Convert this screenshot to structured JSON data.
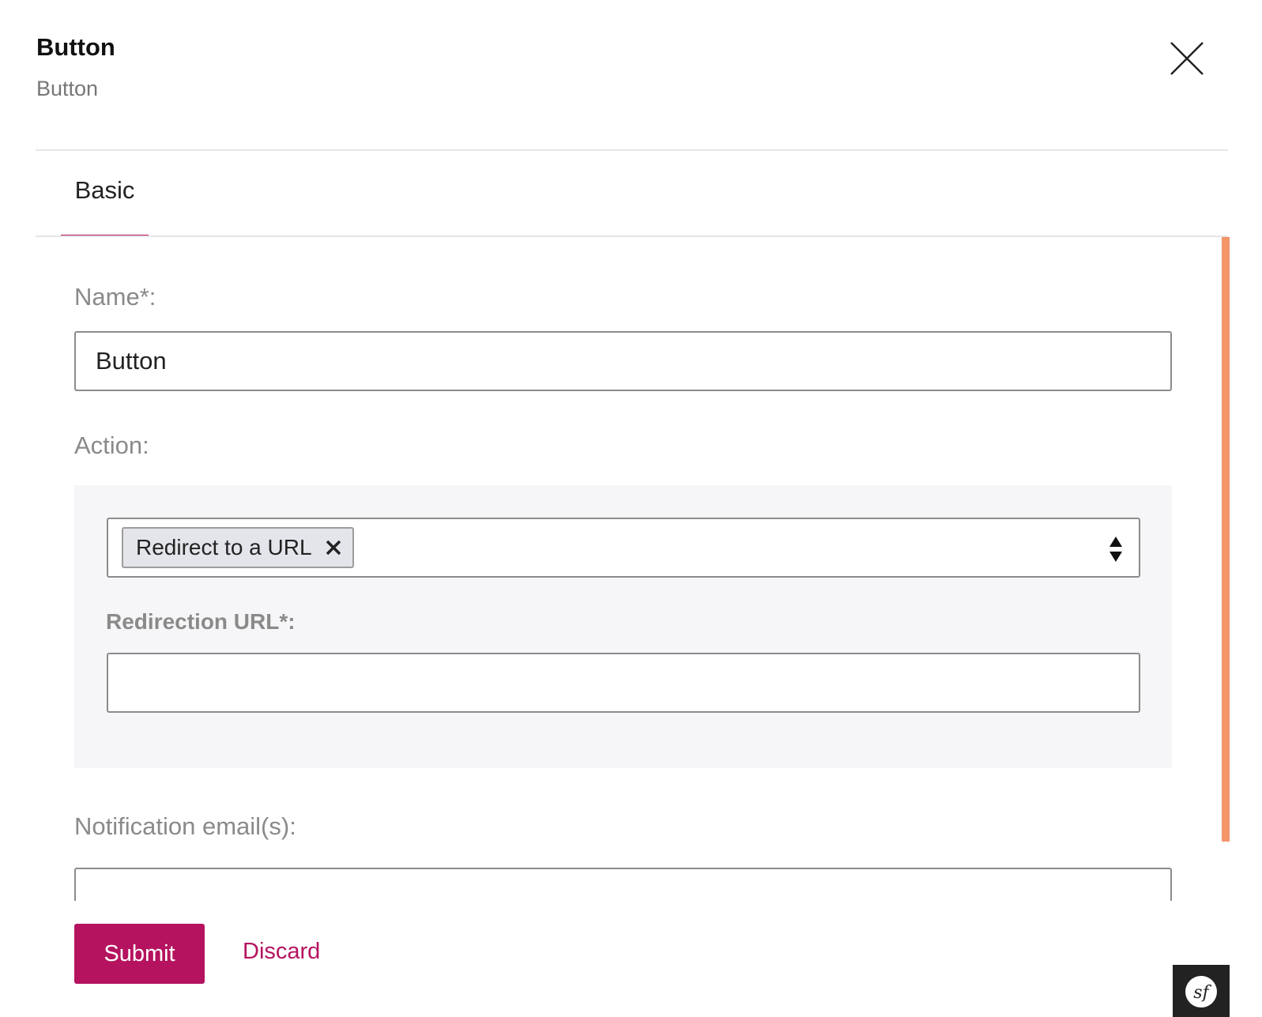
{
  "header": {
    "title": "Button",
    "subtitle": "Button",
    "close_icon": "close-icon"
  },
  "tabs": [
    {
      "label": "Basic",
      "active": true
    }
  ],
  "form": {
    "name": {
      "label": "Name*:",
      "value": "Button"
    },
    "action": {
      "label": "Action:",
      "selected_chip": "Redirect to a URL",
      "chip_remove_icon": "close-small-icon",
      "select_icon": "select-arrows-icon",
      "redirection_url": {
        "label": "Redirection URL*:",
        "value": ""
      }
    },
    "notification_emails": {
      "label": "Notification email(s):",
      "value": ""
    }
  },
  "footer": {
    "submit_label": "Submit",
    "discard_label": "Discard"
  },
  "colors": {
    "accent": "#b5135f",
    "scrollbar": "#f4946b",
    "panel_bg": "#f6f6f8",
    "label": "#8a8a8a"
  },
  "symfony_badge": {
    "icon": "symfony-logo-icon"
  }
}
